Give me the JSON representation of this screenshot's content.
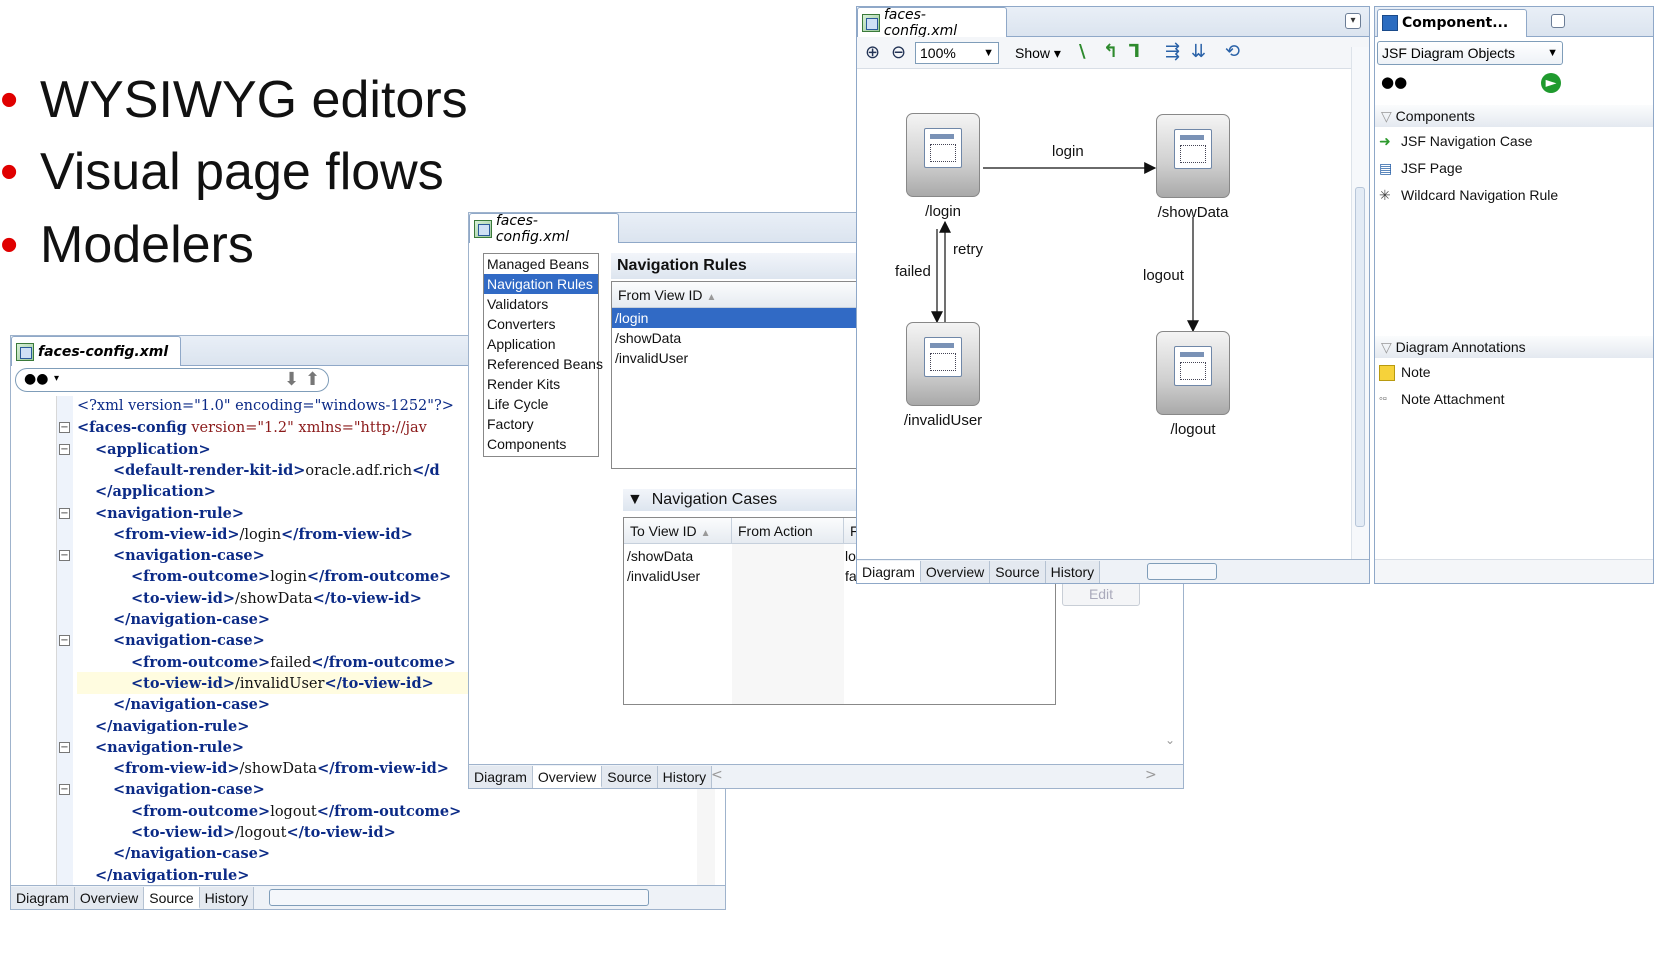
{
  "bullets": [
    "WYSIWYG editors",
    "Visual page flows",
    "Modelers"
  ],
  "colors": {
    "bullet_dot": "#e00000",
    "selection": "#316ac5",
    "tag": "#0b2a86",
    "attr": "#8b1a1a"
  },
  "source_editor": {
    "file_tab": "faces-config.xml",
    "find_icon": "binoculars-icon",
    "lines": [
      {
        "indent": 0,
        "fold": false,
        "parts": [
          [
            "pi",
            "<?xml version=\"1.0\" encoding=\"windows-1252\"?>"
          ]
        ]
      },
      {
        "indent": 0,
        "fold": true,
        "parts": [
          [
            "t",
            "<faces-config"
          ],
          [
            "a",
            " version="
          ],
          [
            "v",
            "\"1.2\""
          ],
          [
            "a",
            " xmlns="
          ],
          [
            "v",
            "\"http://jav"
          ]
        ]
      },
      {
        "indent": 1,
        "fold": true,
        "parts": [
          [
            "t",
            "<application>"
          ]
        ]
      },
      {
        "indent": 2,
        "fold": false,
        "parts": [
          [
            "t",
            "<default-render-kit-id>"
          ],
          [
            "x",
            "oracle.adf.rich"
          ],
          [
            "t",
            "</d"
          ]
        ]
      },
      {
        "indent": 1,
        "fold": false,
        "parts": [
          [
            "t",
            "</application>"
          ]
        ]
      },
      {
        "indent": 1,
        "fold": true,
        "parts": [
          [
            "t",
            "<navigation-rule>"
          ]
        ]
      },
      {
        "indent": 2,
        "fold": false,
        "parts": [
          [
            "t",
            "<from-view-id>"
          ],
          [
            "x",
            "/login"
          ],
          [
            "t",
            "</from-view-id>"
          ]
        ]
      },
      {
        "indent": 2,
        "fold": true,
        "parts": [
          [
            "t",
            "<navigation-case>"
          ]
        ]
      },
      {
        "indent": 3,
        "fold": false,
        "parts": [
          [
            "t",
            "<from-outcome>"
          ],
          [
            "x",
            "login"
          ],
          [
            "t",
            "</from-outcome>"
          ]
        ]
      },
      {
        "indent": 3,
        "fold": false,
        "parts": [
          [
            "t",
            "<to-view-id>"
          ],
          [
            "x",
            "/showData"
          ],
          [
            "t",
            "</to-view-id>"
          ]
        ]
      },
      {
        "indent": 2,
        "fold": false,
        "parts": [
          [
            "t",
            "</navigation-case>"
          ]
        ]
      },
      {
        "indent": 2,
        "fold": true,
        "parts": [
          [
            "t",
            "<navigation-case>"
          ]
        ]
      },
      {
        "indent": 3,
        "fold": false,
        "parts": [
          [
            "t",
            "<from-outcome>"
          ],
          [
            "x",
            "failed"
          ],
          [
            "t",
            "</from-outcome>"
          ]
        ]
      },
      {
        "indent": 3,
        "fold": false,
        "parts": [
          [
            "t",
            "<to-view-id>"
          ],
          [
            "x",
            "/invalidUser"
          ],
          [
            "t",
            "</to-view-id>"
          ]
        ]
      },
      {
        "indent": 2,
        "fold": false,
        "parts": [
          [
            "t",
            "</navigation-case>"
          ]
        ]
      },
      {
        "indent": 1,
        "fold": false,
        "parts": [
          [
            "t",
            "</navigation-rule>"
          ]
        ]
      },
      {
        "indent": 1,
        "fold": true,
        "parts": [
          [
            "t",
            "<navigation-rule>"
          ]
        ]
      },
      {
        "indent": 2,
        "fold": false,
        "parts": [
          [
            "t",
            "<from-view-id>"
          ],
          [
            "x",
            "/showData"
          ],
          [
            "t",
            "</from-view-id>"
          ]
        ]
      },
      {
        "indent": 2,
        "fold": true,
        "parts": [
          [
            "t",
            "<navigation-case>"
          ]
        ]
      },
      {
        "indent": 3,
        "fold": false,
        "parts": [
          [
            "t",
            "<from-outcome>"
          ],
          [
            "x",
            "logout"
          ],
          [
            "t",
            "</from-outcome>"
          ]
        ]
      },
      {
        "indent": 3,
        "fold": false,
        "parts": [
          [
            "t",
            "<to-view-id>"
          ],
          [
            "x",
            "/logout"
          ],
          [
            "t",
            "</to-view-id>"
          ]
        ]
      },
      {
        "indent": 2,
        "fold": false,
        "parts": [
          [
            "t",
            "</navigation-case>"
          ]
        ]
      },
      {
        "indent": 1,
        "fold": false,
        "parts": [
          [
            "t",
            "</navigation-rule>"
          ]
        ]
      }
    ],
    "bottom_tabs": [
      "Diagram",
      "Overview",
      "Source",
      "History"
    ],
    "active_tab": "Source"
  },
  "overview_editor": {
    "file_tab": "faces-config.xml",
    "categories": [
      "Managed Beans",
      "Navigation Rules",
      "Validators",
      "Converters",
      "Application",
      "Referenced Beans",
      "Render Kits",
      "Life Cycle",
      "Factory",
      "Components"
    ],
    "selected_category": "Navigation Rules",
    "rules_header": "Navigation Rules",
    "rules_column": "From View ID",
    "rules": [
      "/login",
      "/showData",
      "/invalidUser"
    ],
    "selected_rule": "/login",
    "cases_header": "Navigation Cases",
    "cases_columns": [
      "To View ID",
      "From Action",
      "F"
    ],
    "cases": [
      [
        "/showData",
        "",
        "lo"
      ],
      [
        "/invalidUser",
        "",
        "fa"
      ]
    ],
    "edit_button": "Edit",
    "bottom_tabs": [
      "Diagram",
      "Overview",
      "Source",
      "History"
    ],
    "active_tab": "Overview"
  },
  "diagram_editor": {
    "file_tab": "faces-config.xml",
    "zoom": "100%",
    "show_label": "Show",
    "nodes": [
      "/login",
      "/showData",
      "/invalidUser",
      "/logout"
    ],
    "edges": [
      "login",
      "failed",
      "retry",
      "logout"
    ],
    "bottom_tabs": [
      "Diagram",
      "Overview",
      "Source",
      "History"
    ],
    "active_tab": "Diagram"
  },
  "palette": {
    "title": "Component...",
    "dropdown": "JSF Diagram Objects",
    "sections": [
      {
        "title": "Components",
        "items": [
          {
            "label": "JSF Navigation Case",
            "icon": "navigation-case-icon"
          },
          {
            "label": "JSF Page",
            "icon": "jsf-page-icon"
          },
          {
            "label": "Wildcard Navigation Rule",
            "icon": "wildcard-rule-icon"
          }
        ]
      },
      {
        "title": "Diagram Annotations",
        "items": [
          {
            "label": "Note",
            "icon": "note-icon"
          },
          {
            "label": "Note Attachment",
            "icon": "note-attachment-icon"
          }
        ]
      }
    ]
  }
}
